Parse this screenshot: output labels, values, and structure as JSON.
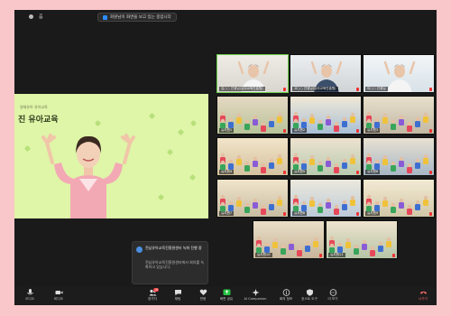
{
  "topbar": {
    "app_title": "줌",
    "share_notice": "회원님이 화면을 보고 있는 중입니다"
  },
  "shared_screen": {
    "subtitle": "영재유아 유아교육",
    "title": "진 유아교육"
  },
  "gallery": {
    "tiles": [
      {
        "name": "김○○ 선생님(유아교육진흥원)",
        "active": true
      },
      {
        "name": "고○○ 선생님(유아교육진흥원)",
        "active": false
      },
      {
        "name": "이○○ 선생님",
        "active": false
      },
      {
        "name": "유치원1",
        "active": false
      },
      {
        "name": "유치원2",
        "active": false
      },
      {
        "name": "유치원3",
        "active": false
      },
      {
        "name": "유치원4",
        "active": false
      },
      {
        "name": "유치원5",
        "active": false
      },
      {
        "name": "유치원6",
        "active": false
      },
      {
        "name": "유치원7",
        "active": false
      },
      {
        "name": "유치원8",
        "active": false
      },
      {
        "name": "유치원9",
        "active": false
      },
      {
        "name": "유치원10",
        "active": false
      },
      {
        "name": "유치원11",
        "active": false
      }
    ]
  },
  "toast": {
    "title": "전남유아교육진흥원센터 녹화 진행 중",
    "body": "전남유아교육진흥원센터에서 회의를 녹화하고 있습니다."
  },
  "toolbar": {
    "audio": "오디오",
    "video": "비디오",
    "participants": "참가자",
    "participant_count": "18",
    "chat": "채팅",
    "react": "반응",
    "share": "화면 공유",
    "ai": "AI Companion",
    "info": "회의 정보",
    "host_tools": "호스트 도구",
    "more": "더 보기",
    "end": "나가기"
  },
  "colors": {
    "page_bg": "#f9c6c9",
    "app_bg": "#1a1a1a",
    "share_bg": "#dff5a8",
    "active_outline": "#6ccf4a",
    "share_green": "#27c241",
    "end_red": "#ff6b6b"
  }
}
